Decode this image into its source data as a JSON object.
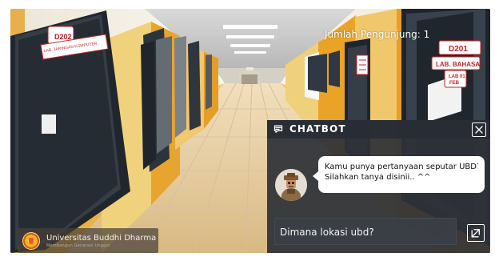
{
  "scene": {
    "visitor_count_text": "Jumlah Pengunjung: 1",
    "door_signs": {
      "left_room": "D202",
      "left_lab": "LAB. JARINGAN KOMPUTER",
      "right_room": "D201",
      "right_lab": "LAB. BAHASA",
      "right_lab_2": "LAB 01",
      "right_dept": "FEB"
    }
  },
  "branding": {
    "name": "Universitas Buddhi Dharma",
    "tagline": "Membangun Generasi Unggul"
  },
  "chatbot": {
    "title": "CHATBOT",
    "header_icon": "chat-icon",
    "close_icon": "close-icon",
    "message_lines": [
      "Kamu punya pertanyaan seputar UBD?",
      "Silahkan tanya disinii.. ^^"
    ],
    "input_value": "Dimana lokasi ubd?",
    "send_icon": "send-icon"
  },
  "colors": {
    "wall": "#e8a92b",
    "door": "#20262d",
    "chat_panel": "#2e3238",
    "chat_header": "#282c34",
    "bubble": "#ffffff",
    "sign_red": "#d52d2d"
  }
}
